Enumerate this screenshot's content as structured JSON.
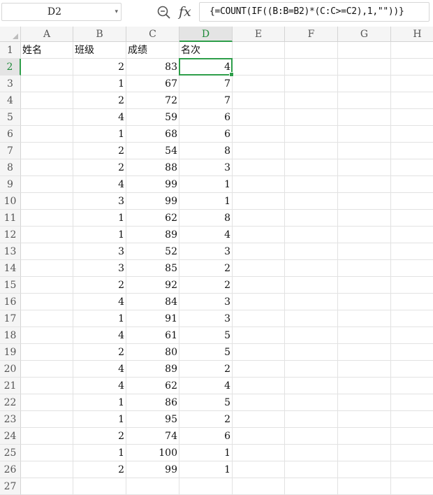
{
  "formula_bar": {
    "name_box": "D2",
    "fx_label": "fx",
    "formula": "{=COUNT(IF((B:B=B2)*(C:C>=C2),1,\"\"))}"
  },
  "sheet": {
    "columns": [
      "A",
      "B",
      "C",
      "D",
      "E",
      "F",
      "G",
      "H"
    ],
    "active_cell": "D2",
    "headers": {
      "A": "姓名",
      "B": "班级",
      "C": "成绩",
      "D": "名次"
    },
    "rows": [
      {
        "n": "1"
      },
      {
        "n": "2",
        "B": "2",
        "C": "83",
        "D": "4"
      },
      {
        "n": "3",
        "B": "1",
        "C": "67",
        "D": "7"
      },
      {
        "n": "4",
        "B": "2",
        "C": "72",
        "D": "7"
      },
      {
        "n": "5",
        "B": "4",
        "C": "59",
        "D": "6"
      },
      {
        "n": "6",
        "B": "1",
        "C": "68",
        "D": "6"
      },
      {
        "n": "7",
        "B": "2",
        "C": "54",
        "D": "8"
      },
      {
        "n": "8",
        "B": "2",
        "C": "88",
        "D": "3"
      },
      {
        "n": "9",
        "B": "4",
        "C": "99",
        "D": "1"
      },
      {
        "n": "10",
        "B": "3",
        "C": "99",
        "D": "1"
      },
      {
        "n": "11",
        "B": "1",
        "C": "62",
        "D": "8"
      },
      {
        "n": "12",
        "B": "1",
        "C": "89",
        "D": "4"
      },
      {
        "n": "13",
        "B": "3",
        "C": "52",
        "D": "3"
      },
      {
        "n": "14",
        "B": "3",
        "C": "85",
        "D": "2"
      },
      {
        "n": "15",
        "B": "2",
        "C": "92",
        "D": "2"
      },
      {
        "n": "16",
        "B": "4",
        "C": "84",
        "D": "3"
      },
      {
        "n": "17",
        "B": "1",
        "C": "91",
        "D": "3"
      },
      {
        "n": "18",
        "B": "4",
        "C": "61",
        "D": "5"
      },
      {
        "n": "19",
        "B": "2",
        "C": "80",
        "D": "5"
      },
      {
        "n": "20",
        "B": "4",
        "C": "89",
        "D": "2"
      },
      {
        "n": "21",
        "B": "4",
        "C": "62",
        "D": "4"
      },
      {
        "n": "22",
        "B": "1",
        "C": "86",
        "D": "5"
      },
      {
        "n": "23",
        "B": "1",
        "C": "95",
        "D": "2"
      },
      {
        "n": "24",
        "B": "2",
        "C": "74",
        "D": "6"
      },
      {
        "n": "25",
        "B": "1",
        "C": "100",
        "D": "1"
      },
      {
        "n": "26",
        "B": "2",
        "C": "99",
        "D": "1"
      },
      {
        "n": "27"
      }
    ]
  },
  "colors": {
    "accent": "#2e9e4a",
    "grid": "#e2e2e2",
    "header_bg": "#f5f5f5"
  }
}
